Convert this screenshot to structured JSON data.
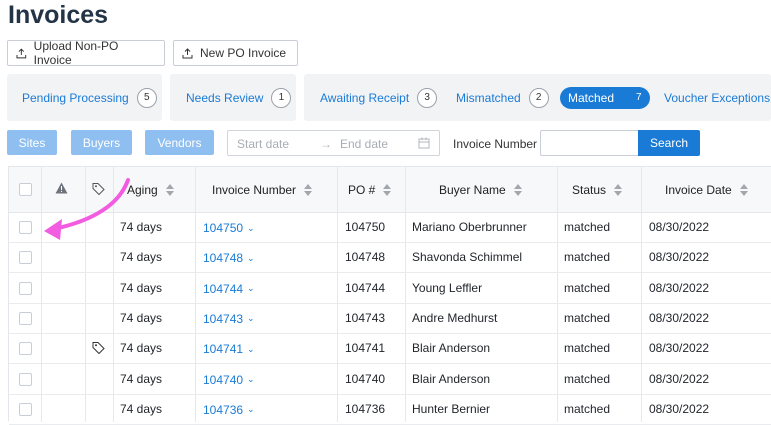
{
  "page": {
    "title": "Invoices"
  },
  "actions": {
    "upload_label": "Upload Non-PO Invoice",
    "new_po_label": "New PO Invoice"
  },
  "tabs": [
    {
      "label": "Pending Processing",
      "count": "5"
    },
    {
      "label": "Needs Review",
      "count": "1"
    },
    {
      "label": "Awaiting Receipt",
      "count": "3"
    },
    {
      "label": "Mismatched",
      "count": "2"
    },
    {
      "label": "Matched",
      "count": "7",
      "active": true
    },
    {
      "label": "Voucher Exceptions",
      "count": ""
    }
  ],
  "filters": {
    "sites_label": "Sites",
    "buyers_label": "Buyers",
    "vendors_label": "Vendors",
    "start_date_placeholder": "Start date",
    "end_date_placeholder": "End date",
    "invoice_number_label": "Invoice Number",
    "invoice_number_value": "",
    "search_label": "Search"
  },
  "table": {
    "columns": [
      "Aging",
      "Invoice Number",
      "PO #",
      "Buyer Name",
      "Status",
      "Invoice Date"
    ],
    "rows": [
      {
        "aging": "74 days",
        "invoice": "104750",
        "po": "104750",
        "buyer": "Mariano Oberbrunner",
        "status": "matched",
        "date": "08/30/2022",
        "tag": false
      },
      {
        "aging": "74 days",
        "invoice": "104748",
        "po": "104748",
        "buyer": "Shavonda Schimmel",
        "status": "matched",
        "date": "08/30/2022",
        "tag": false
      },
      {
        "aging": "74 days",
        "invoice": "104744",
        "po": "104744",
        "buyer": "Young Leffler",
        "status": "matched",
        "date": "08/30/2022",
        "tag": false
      },
      {
        "aging": "74 days",
        "invoice": "104743",
        "po": "104743",
        "buyer": "Andre Medhurst",
        "status": "matched",
        "date": "08/30/2022",
        "tag": false
      },
      {
        "aging": "74 days",
        "invoice": "104741",
        "po": "104741",
        "buyer": "Blair Anderson",
        "status": "matched",
        "date": "08/30/2022",
        "tag": true
      },
      {
        "aging": "74 days",
        "invoice": "104740",
        "po": "104740",
        "buyer": "Blair Anderson",
        "status": "matched",
        "date": "08/30/2022",
        "tag": false
      },
      {
        "aging": "74 days",
        "invoice": "104736",
        "po": "104736",
        "buyer": "Hunter Bernier",
        "status": "matched",
        "date": "08/30/2022",
        "tag": false
      }
    ]
  },
  "colors": {
    "accent": "#1a7bd6",
    "filter_button": "#8fbff0",
    "annotation_arrow": "#f25ce0"
  },
  "icons": {
    "upload": "upload-icon",
    "warning": "warning-icon",
    "tag": "tag-icon",
    "calendar": "calendar-icon",
    "chevron": "chevron-down-icon"
  }
}
